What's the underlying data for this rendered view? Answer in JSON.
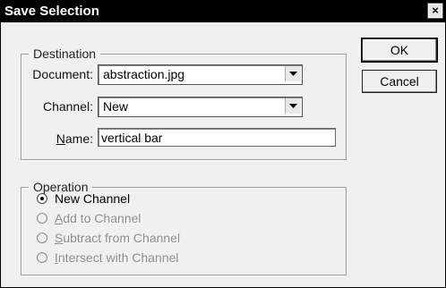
{
  "window": {
    "title": "Save Selection",
    "close_glyph": "×"
  },
  "destination": {
    "legend": "Destination",
    "document_label": "Document:",
    "document_value": "abstraction.jpg",
    "channel_label": "Channel:",
    "channel_value": "New",
    "name_label_accel": "N",
    "name_label_rest": "ame:",
    "name_value": "vertical bar"
  },
  "operation": {
    "legend": "Operation",
    "options": [
      {
        "accel": "",
        "rest": "New Channel",
        "selected": true,
        "enabled": true
      },
      {
        "accel": "A",
        "rest": "dd to Channel",
        "selected": false,
        "enabled": false
      },
      {
        "accel": "S",
        "rest": "ubtract from Channel",
        "selected": false,
        "enabled": false
      },
      {
        "accel": "I",
        "rest": "ntersect with Channel",
        "selected": false,
        "enabled": false
      }
    ]
  },
  "buttons": {
    "ok": "OK",
    "cancel": "Cancel"
  },
  "colors": {
    "titlebar": "#000000",
    "face": "#f0f0f0",
    "disabled_text": "#8a8a8a"
  }
}
